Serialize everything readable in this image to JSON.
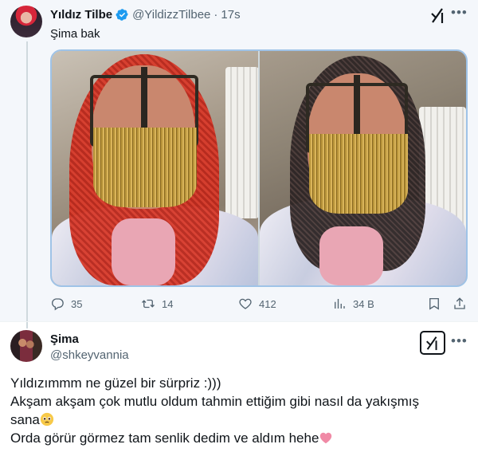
{
  "tweet": {
    "author_name": "Yıldız Tilbe",
    "author_handle": "@YildizzTilbee",
    "separator": "·",
    "time": "17s",
    "text": "Şima bak",
    "stats": {
      "replies": "35",
      "retweets": "14",
      "likes": "412",
      "views": "34 B"
    }
  },
  "reply": {
    "author_name": "Şima",
    "author_handle": "@shkeyvannia",
    "lines": [
      "Yıldızımmm ne güzel bir sürpriz :)))",
      "Akşam akşam çok mutlu oldum tahmin ettiğim gibi nasıl da yakışmış",
      "sana",
      "Orda görür görmez tam senlik dedim ve aldım hehe"
    ]
  },
  "icons": {
    "verified": "verified-badge-icon",
    "grok": "grok-icon",
    "more": "more-options-icon",
    "reply": "reply-icon",
    "retweet": "retweet-icon",
    "like": "heart-icon",
    "views": "analytics-icon",
    "bookmark": "bookmark-icon",
    "share": "share-icon",
    "emoji_1": "pleading-face-emoji",
    "emoji_2": "pink-heart-emoji"
  },
  "colors": {
    "verified_blue": "#1d9bf0",
    "secondary_text": "#536471",
    "highlight_bg": "#f4f7fb",
    "media_border": "#9fc3e7",
    "heart_pink": "#f08aa6"
  }
}
